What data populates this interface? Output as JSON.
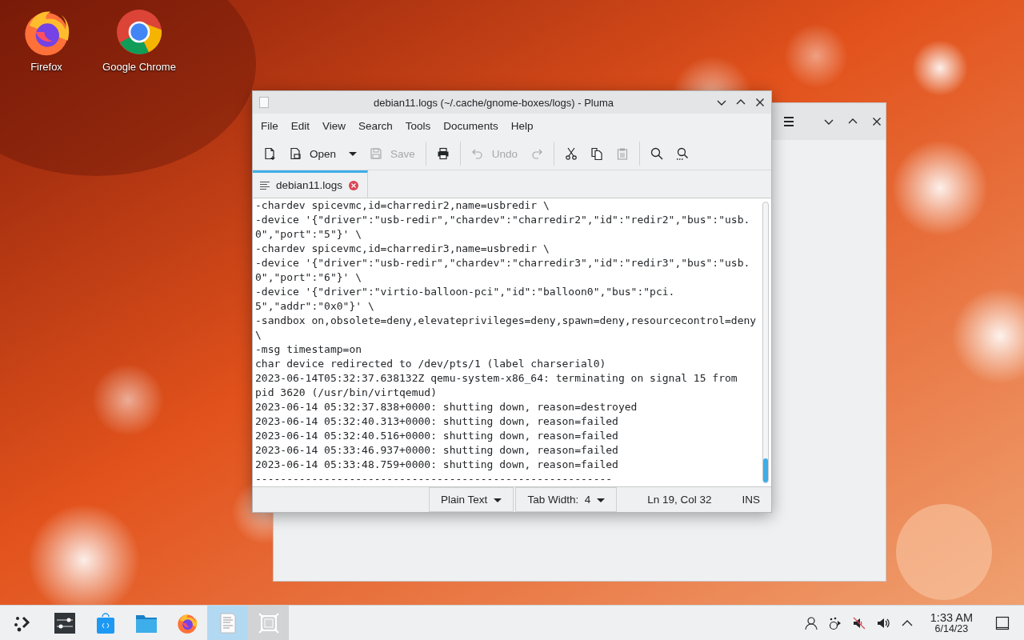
{
  "desktop_icons": [
    {
      "kind": "firefox",
      "label": "Firefox"
    },
    {
      "kind": "chrome",
      "label": "Google Chrome"
    }
  ],
  "editor": {
    "title": "debian11.logs (~/.cache/gnome-boxes/logs) - Pluma",
    "menu": [
      "File",
      "Edit",
      "View",
      "Search",
      "Tools",
      "Documents",
      "Help"
    ],
    "toolbar": [
      {
        "kind": "new",
        "disabled": false
      },
      {
        "kind": "open",
        "label": "Open",
        "disabled": false
      },
      {
        "kind": "dropdown",
        "disabled": false
      },
      {
        "kind": "save",
        "label": "Save",
        "disabled": true
      },
      {
        "kind": "separator"
      },
      {
        "kind": "print",
        "disabled": false
      },
      {
        "kind": "separator"
      },
      {
        "kind": "undo",
        "label": "Undo",
        "disabled": true
      },
      {
        "kind": "redo",
        "disabled": true
      },
      {
        "kind": "separator"
      },
      {
        "kind": "cut",
        "disabled": false
      },
      {
        "kind": "copy",
        "disabled": false
      },
      {
        "kind": "paste",
        "disabled": true
      },
      {
        "kind": "separator"
      },
      {
        "kind": "find",
        "disabled": false
      },
      {
        "kind": "replace",
        "disabled": false
      }
    ],
    "tabs": [
      {
        "label": "debian11.logs",
        "selected": true
      }
    ],
    "lines": [
      "-chardev spicevmc,id=charredir2,name=usbredir \\",
      "-device '{\"driver\":\"usb-redir\",\"chardev\":\"charredir2\",\"id\":\"redir2\",\"bus\":\"usb.",
      "0\",\"port\":\"5\"}' \\",
      "-chardev spicevmc,id=charredir3,name=usbredir \\",
      "-device '{\"driver\":\"usb-redir\",\"chardev\":\"charredir3\",\"id\":\"redir3\",\"bus\":\"usb.",
      "0\",\"port\":\"6\"}' \\",
      "-device '{\"driver\":\"virtio-balloon-pci\",\"id\":\"balloon0\",\"bus\":\"pci.",
      "5\",\"addr\":\"0x0\"}' \\",
      "-sandbox on,obsolete=deny,elevateprivileges=deny,spawn=deny,resourcecontrol=deny",
      "\\",
      "-msg timestamp=on",
      "char device redirected to /dev/pts/1 (label charserial0)",
      "2023-06-14T05:32:37.638132Z qemu-system-x86_64: terminating on signal 15 from",
      "pid 3620 (/usr/bin/virtqemud)",
      "2023-06-14 05:32:37.838+0000: shutting down, reason=destroyed",
      "2023-06-14 05:32:40.313+0000: shutting down, reason=failed",
      "2023-06-14 05:32:40.516+0000: shutting down, reason=failed",
      "2023-06-14 05:33:46.937+0000: shutting down, reason=failed",
      "2023-06-14 05:33:48.759+0000: shutting down, reason=failed",
      "---------------------------------------------------------"
    ],
    "status": {
      "language": "Plain Text",
      "tab_width": "Tab Width:  4",
      "position": "Ln 19, Col 32",
      "mode": "INS"
    }
  },
  "taskbar": {
    "items": [
      {
        "kind": "launcher",
        "selected": false,
        "hovered": false
      },
      {
        "kind": "settings",
        "selected": false,
        "hovered": false
      },
      {
        "kind": "store",
        "selected": false,
        "hovered": false
      },
      {
        "kind": "folder",
        "selected": false,
        "hovered": false
      },
      {
        "kind": "firefox",
        "selected": false,
        "hovered": false
      },
      {
        "kind": "editor",
        "selected": true,
        "hovered": false
      },
      {
        "kind": "boxes",
        "selected": false,
        "hovered": true
      }
    ],
    "tray": [
      {
        "kind": "user"
      },
      {
        "kind": "network"
      },
      {
        "kind": "muted"
      },
      {
        "kind": "volume"
      },
      {
        "kind": "expand"
      }
    ],
    "clock": {
      "time": "1:33 AM",
      "date": "6/14/23"
    }
  }
}
